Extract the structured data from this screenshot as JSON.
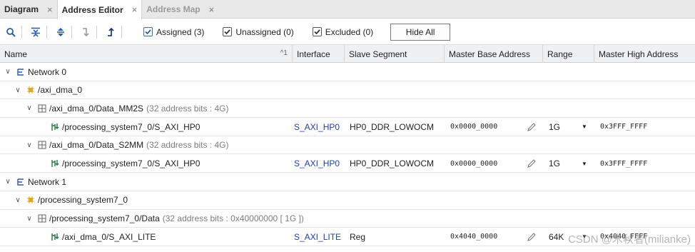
{
  "tabs": [
    {
      "label": "Diagram",
      "close": "×",
      "active": false,
      "muted": false
    },
    {
      "label": "Address Editor",
      "close": "×",
      "active": true,
      "muted": false
    },
    {
      "label": "Address Map",
      "close": "×",
      "active": false,
      "muted": true
    }
  ],
  "toolbar": {
    "icons": [
      "search-icon",
      "collapse-all-icon",
      "expand-all-icon",
      "assign-icon",
      "auto-assign-icon"
    ],
    "assigned_label": "Assigned (3)",
    "unassigned_label": "Unassigned (0)",
    "excluded_label": "Excluded (0)",
    "hide_all_label": "Hide All"
  },
  "columns": {
    "name": "Name",
    "sort_indicator": "^1",
    "interface": "Interface",
    "slave_segment": "Slave Segment",
    "master_base_address": "Master Base Address",
    "range": "Range",
    "master_high_address": "Master High Address"
  },
  "rows": {
    "r0": {
      "name": "Network 0",
      "twisty": "∨"
    },
    "r1": {
      "name": "/axi_dma_0",
      "twisty": "∨"
    },
    "r2": {
      "name": "/axi_dma_0/Data_MM2S",
      "note": "(32 address bits : 4G)",
      "twisty": "∨"
    },
    "r3": {
      "name": "/processing_system7_0/S_AXI_HP0",
      "interface": "S_AXI_HP0",
      "slave_segment": "HP0_DDR_LOWOCM",
      "base": "0x0000_0000",
      "range": "1G",
      "high": "0x3FFF_FFFF"
    },
    "r4": {
      "name": "/axi_dma_0/Data_S2MM",
      "note": "(32 address bits : 4G)",
      "twisty": "∨"
    },
    "r5": {
      "name": "/processing_system7_0/S_AXI_HP0",
      "interface": "S_AXI_HP0",
      "slave_segment": "HP0_DDR_LOWOCM",
      "base": "0x0000_0000",
      "range": "1G",
      "high": "0x3FFF_FFFF"
    },
    "r6": {
      "name": "Network 1",
      "twisty": "∨"
    },
    "r7": {
      "name": "/processing_system7_0",
      "twisty": "∨"
    },
    "r8": {
      "name": "/processing_system7_0/Data",
      "note": "(32 address bits : 0x40000000 [ 1G ])",
      "twisty": "∨"
    },
    "r9": {
      "name": "/axi_dma_0/S_AXI_LITE",
      "interface": "S_AXI_LITE",
      "slave_segment": "Reg",
      "base": "0x4040_0000",
      "range": "64K",
      "high": "0x4040_FFFF"
    }
  },
  "watermark": "CSDN @木秋者(milianke)",
  "colors": {
    "link": "#1d3fb8",
    "header_bg": "#eef1f4",
    "tab_bg": "#e8e8e8"
  }
}
